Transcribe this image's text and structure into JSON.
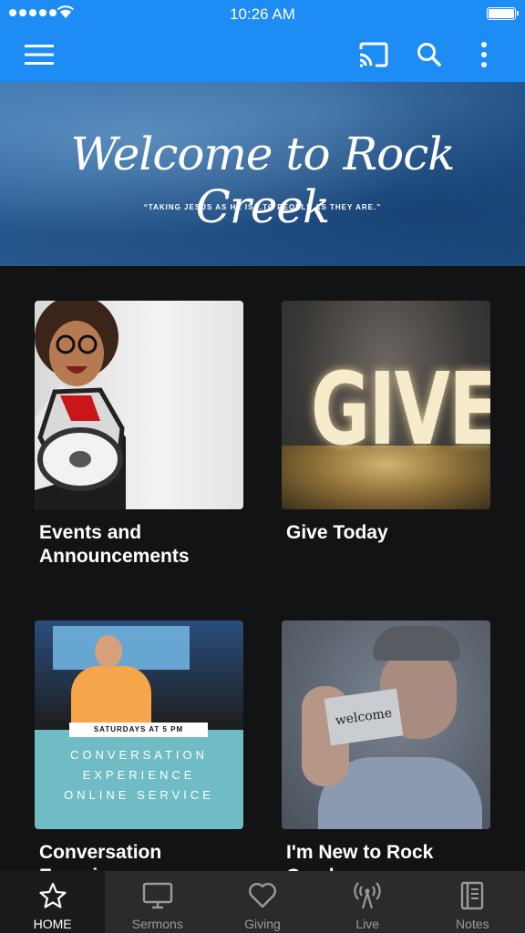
{
  "status_bar": {
    "time": "10:26 AM"
  },
  "app_bar": {
    "menu_icon": "hamburger-menu-icon",
    "cast_icon": "cast-icon",
    "search_icon": "search-icon",
    "more_icon": "more-vertical-icon"
  },
  "hero": {
    "title": "Welcome to Rock Creek",
    "subtitle": "“TAKING JESUS AS HE IS...TO PEOPLE AS THEY ARE.”"
  },
  "cards": [
    {
      "title": "Events and Announcements"
    },
    {
      "title": "Give Today",
      "image_text": "GIVE"
    },
    {
      "title": "Conversation Experience",
      "image_lines": [
        "SATURDAYS AT 5 PM",
        "CONVERSATION",
        "EXPERIENCE",
        "ONLINE SERVICE"
      ]
    },
    {
      "title": "I'm New to Rock Creek",
      "image_text": "welcome"
    }
  ],
  "tab_bar": {
    "tabs": [
      {
        "label": "HOME",
        "icon": "star-icon",
        "active": true
      },
      {
        "label": "Sermons",
        "icon": "tv-icon",
        "active": false
      },
      {
        "label": "Giving",
        "icon": "heart-icon",
        "active": false
      },
      {
        "label": "Live",
        "icon": "broadcast-icon",
        "active": false
      },
      {
        "label": "Notes",
        "icon": "notebook-icon",
        "active": false
      }
    ]
  },
  "colors": {
    "primary": "#1e8cf5",
    "background": "#121315",
    "tab_bar": "#2b2b2d",
    "tab_inactive": "#9a9a9c"
  }
}
